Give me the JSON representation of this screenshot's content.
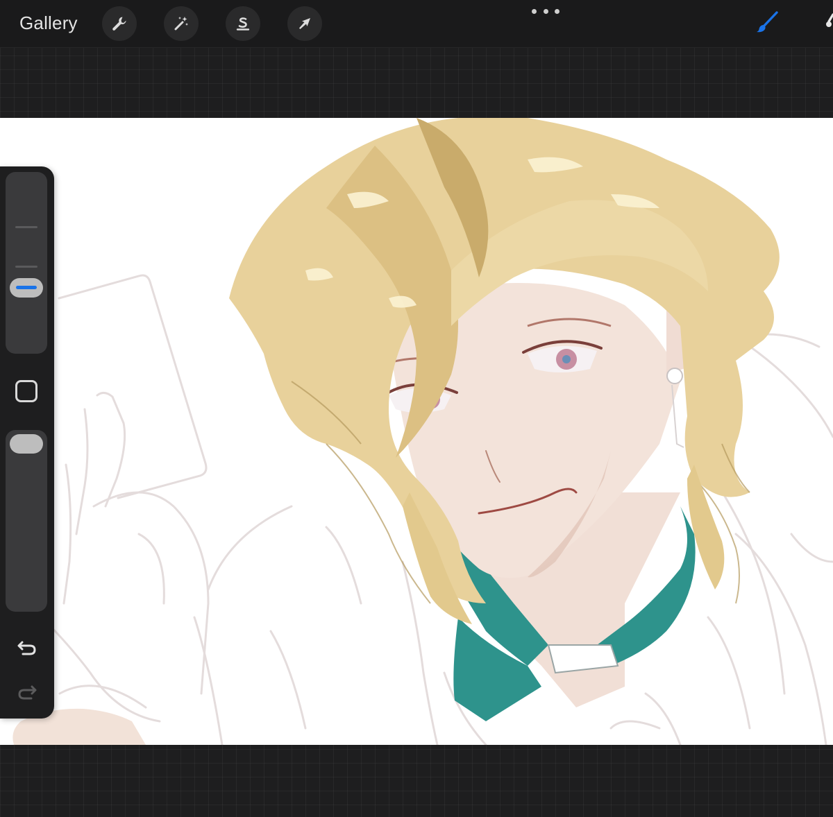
{
  "toolbar": {
    "gallery_label": "Gallery",
    "tools": [
      {
        "name": "actions",
        "icon": "wrench-icon"
      },
      {
        "name": "adjustments",
        "icon": "magic-wand-icon"
      },
      {
        "name": "selection",
        "icon": "selection-s-icon"
      },
      {
        "name": "transform",
        "icon": "arrow-cursor-icon"
      }
    ],
    "more_icon": "more-dots-icon",
    "brush_icon": "brush-icon",
    "brush_color": "#1a73e8",
    "smudge_icon": "smudge-icon"
  },
  "sidebar": {
    "brush_size_icon": "brush-size-slider",
    "opacity_icon": "opacity-slider",
    "modify_icon": "square-modify-icon",
    "undo_icon": "undo-icon",
    "redo_icon": "redo-icon",
    "brush_size_level": 0.6,
    "opacity_level": 0.95,
    "active_color": "#1a73e8"
  },
  "canvas": {
    "artwork": "character-portrait",
    "colors": {
      "hair": "#e9d39a",
      "hair_shadow": "#b79a5f",
      "skin": "#f3e2d9",
      "collar": "#2e938c",
      "sketch": "#e3dada"
    }
  }
}
